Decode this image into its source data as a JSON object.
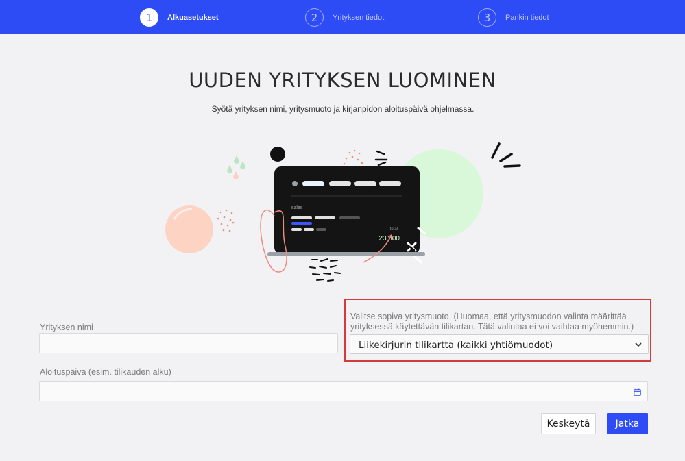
{
  "stepper": {
    "steps": [
      {
        "number": "1",
        "label": "Alkuasetukset",
        "active": true
      },
      {
        "number": "2",
        "label": "Yrityksen tiedot",
        "active": false
      },
      {
        "number": "3",
        "label": "Pankin tiedot",
        "active": false
      }
    ]
  },
  "page": {
    "title": "UUDEN YRITYKSEN LUOMINEN",
    "subtitle": "Syötä yrityksen nimi, yritysmuoto ja kirjanpidon aloituspäivä ohjelmassa."
  },
  "illustration": {
    "chart_label": "sales",
    "total_label": "total",
    "total_value": "23 300"
  },
  "form": {
    "company_name_label": "Yrityksen nimi",
    "company_name_value": "",
    "company_type_label": "Valitse sopiva yritysmuoto. (Huomaa, että yritysmuodon valinta määrittää yrityksessä käytettävän tilikartan. Tätä valintaa ei voi vaihtaa myöhemmin.)",
    "company_type_selected": "Liikekirjurin tilikartta (kaikki yhtiömuodot)",
    "start_date_label": "Aloituspäivä (esim. tilikauden alku)",
    "start_date_value": ""
  },
  "buttons": {
    "cancel": "Keskeytä",
    "next": "Jatka"
  },
  "colors": {
    "accent": "#2d4cf5",
    "highlight_border": "#d33b3b",
    "background": "#f2f2f4"
  }
}
